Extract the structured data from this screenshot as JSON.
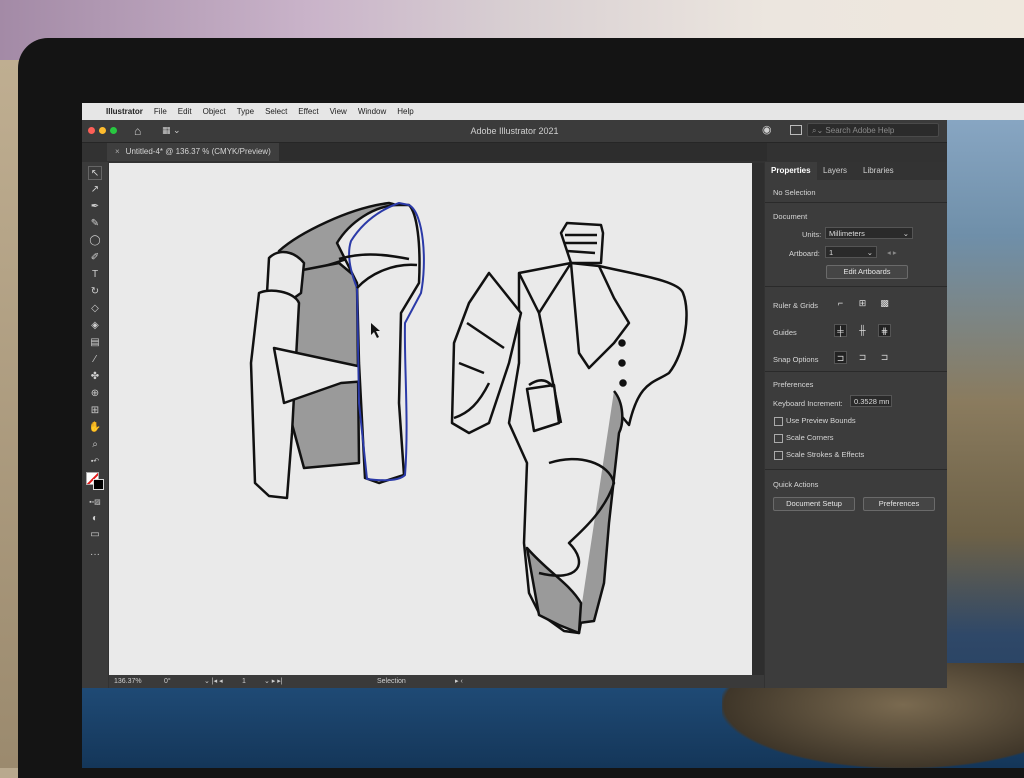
{
  "mac_menu": {
    "apple": "",
    "app": "Illustrator",
    "items": [
      "File",
      "Edit",
      "Object",
      "Type",
      "Select",
      "Effect",
      "View",
      "Window",
      "Help"
    ]
  },
  "window": {
    "title": "Adobe Illustrator 2021",
    "search_placeholder": "Search Adobe Help"
  },
  "document_tab": {
    "close": "×",
    "label": "Untitled-4* @ 136.37 % (CMYK/Preview)"
  },
  "status": {
    "zoom": "136.37%",
    "rotation": "0°",
    "artboard": "1",
    "tool": "Selection"
  },
  "panel": {
    "tabs": [
      "Properties",
      "Layers",
      "Libraries"
    ],
    "selection": "No Selection",
    "document_heading": "Document",
    "units_label": "Units:",
    "units_value": "Millimeters",
    "artboard_label": "Artboard:",
    "artboard_value": "1",
    "edit_artboards": "Edit Artboards",
    "rulers_grids": "Ruler & Grids",
    "guides": "Guides",
    "snap_options": "Snap Options",
    "preferences_heading": "Preferences",
    "keyboard_increment_label": "Keyboard Increment:",
    "keyboard_increment_value": "0.3528 mn",
    "use_preview_bounds": "Use Preview Bounds",
    "scale_corners": "Scale Corners",
    "scale_strokes": "Scale Strokes & Effects",
    "quick_actions": "Quick Actions",
    "document_setup": "Document Setup",
    "preferences_button": "Preferences"
  },
  "colors": {
    "accent_selection": "#3b4bb0",
    "traffic_red": "#fe5f57",
    "traffic_yellow": "#febc2e",
    "traffic_green": "#28c840"
  }
}
